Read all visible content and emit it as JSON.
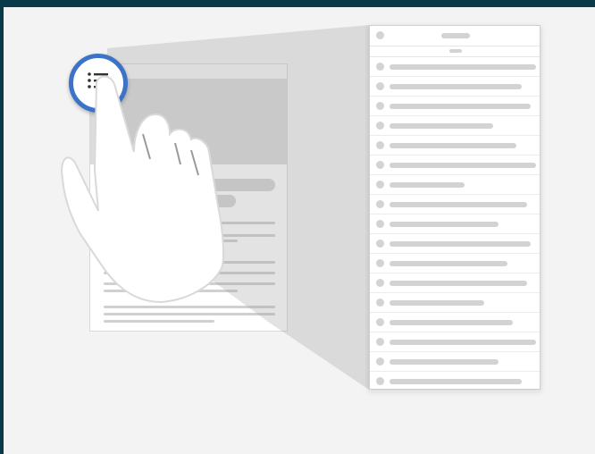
{
  "illustration": {
    "menu_button_icon": "list-menu-icon",
    "gesture_icon": "tap-hand-icon",
    "accent_color": "#3b73c9",
    "background_color": "#0a3a4a",
    "panel_row_count": 17
  }
}
